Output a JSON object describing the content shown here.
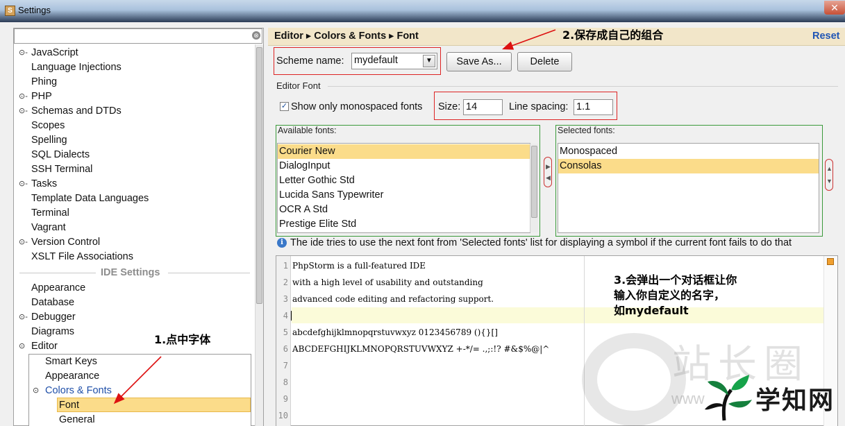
{
  "window": {
    "title": "Settings",
    "close_glyph": "✕"
  },
  "search": {
    "value": "",
    "clear_glyph": "⊗"
  },
  "sidebar": {
    "items": [
      {
        "label": "JavaScript",
        "toggle": "⊙-"
      },
      {
        "label": "Language Injections",
        "toggle": ""
      },
      {
        "label": "Phing",
        "toggle": ""
      },
      {
        "label": "PHP",
        "toggle": "⊙-"
      },
      {
        "label": "Schemas and DTDs",
        "toggle": "⊙-"
      },
      {
        "label": "Scopes",
        "toggle": ""
      },
      {
        "label": "Spelling",
        "toggle": ""
      },
      {
        "label": "SQL Dialects",
        "toggle": ""
      },
      {
        "label": "SSH Terminal",
        "toggle": ""
      },
      {
        "label": "Tasks",
        "toggle": "⊙-"
      },
      {
        "label": "Template Data Languages",
        "toggle": ""
      },
      {
        "label": "Terminal",
        "toggle": ""
      },
      {
        "label": "Vagrant",
        "toggle": ""
      },
      {
        "label": "Version Control",
        "toggle": "⊙-"
      },
      {
        "label": "XSLT File Associations",
        "toggle": ""
      }
    ],
    "section_label": "IDE Settings",
    "ide_items": [
      {
        "label": "Appearance",
        "toggle": ""
      },
      {
        "label": "Database",
        "toggle": ""
      },
      {
        "label": "Debugger",
        "toggle": "⊙-"
      },
      {
        "label": "Diagrams",
        "toggle": ""
      },
      {
        "label": "Editor",
        "toggle": "⊙"
      }
    ],
    "editor_children": [
      {
        "label": "Smart Keys",
        "toggle": ""
      },
      {
        "label": "Appearance",
        "toggle": ""
      },
      {
        "label": "Colors & Fonts",
        "toggle": "⊙"
      },
      {
        "label": "Font",
        "toggle": ""
      },
      {
        "label": "General",
        "toggle": ""
      }
    ]
  },
  "breadcrumb": {
    "text": "Editor ▸ Colors & Fonts ▸ Font",
    "reset_label": "Reset"
  },
  "scheme": {
    "label": "Scheme name:",
    "value": "mydefault",
    "save_as_label": "Save As...",
    "delete_label": "Delete"
  },
  "editor_font": {
    "title": "Editor Font",
    "mono_label": "Show only monospaced fonts",
    "mono_checked": true,
    "size_label": "Size:",
    "size_value": "14",
    "line_spacing_label": "Line spacing:",
    "line_spacing_value": "1.1"
  },
  "available_fonts": {
    "title": "Available fonts:",
    "items": [
      "Courier New",
      "DialogInput",
      "Letter Gothic Std",
      "Lucida Sans Typewriter",
      "OCR A Std",
      "Prestige Elite Std"
    ],
    "selected": "Courier New"
  },
  "selected_fonts": {
    "title": "Selected fonts:",
    "items": [
      "Monospaced",
      "Consolas"
    ],
    "selected": "Consolas"
  },
  "info": {
    "text": "The ide tries to use the next font from 'Selected fonts' list for displaying a symbol if the current font fails to do that"
  },
  "preview": {
    "line_numbers": [
      "1",
      "2",
      "3",
      "4",
      "5",
      "6",
      "7",
      "8",
      "9",
      "10"
    ],
    "lines": [
      "PhpStorm is a full-featured IDE",
      "with a high level of usability and outstanding",
      "advanced code editing and refactoring support.",
      "",
      "abcdefghijklmnopqrstuvwxyz 0123456789 (){}[]",
      "ABCDEFGHIJKLMNOPQRSTUVWXYZ +-*/= .,;:!? #&$%@|^",
      "",
      "",
      "",
      ""
    ]
  },
  "annotations": {
    "step1": "1.点中字体",
    "step2": "2.保存成自己的组合",
    "step3_line1": "3.会弹出一个对话框让你",
    "step3_line2": "输入你自定义的名字，",
    "step3_line3": "如mydefault"
  },
  "watermark": {
    "text": "站长圈",
    "www": "www",
    "brand": "学知网"
  },
  "colors": {
    "selection": "#fbdc8a",
    "reset_link": "#1f55b5",
    "highlight_box": "#d22222",
    "group_border": "#3a9a3a"
  }
}
